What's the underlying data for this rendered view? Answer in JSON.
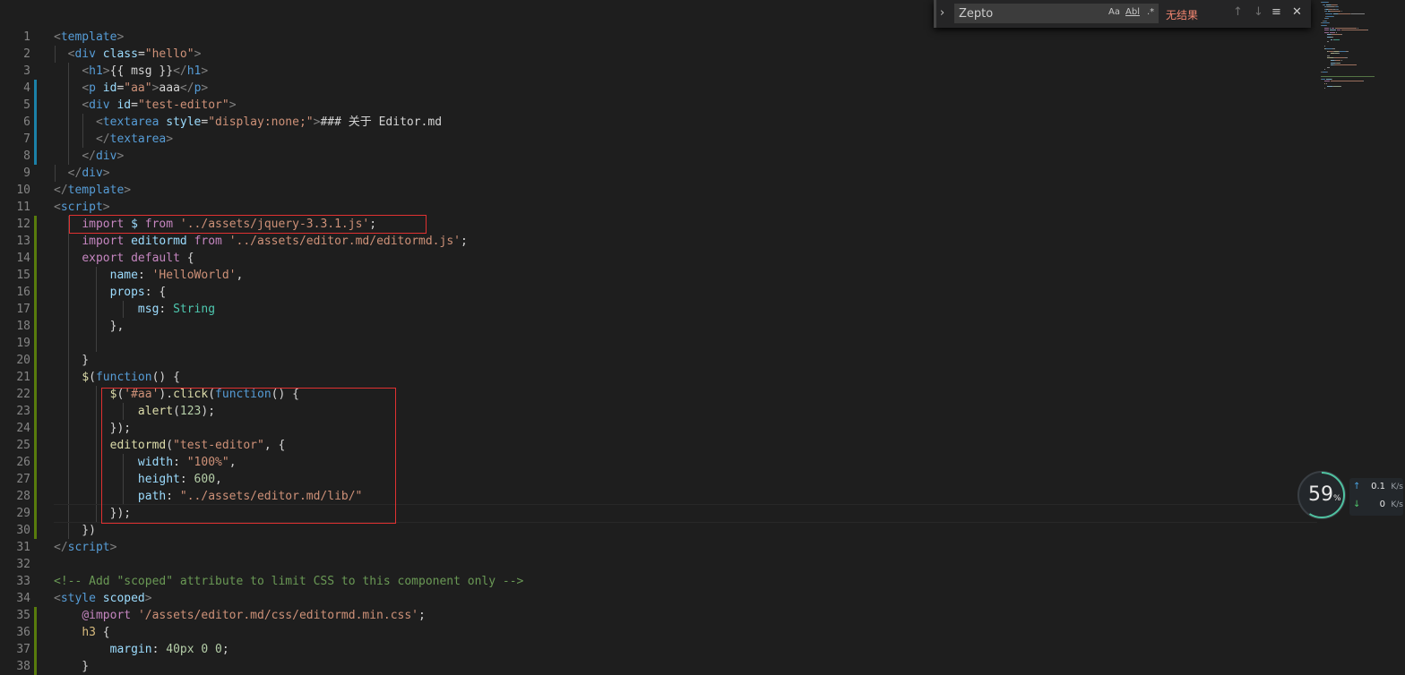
{
  "colors": {
    "accent": "#1b81a8",
    "added": "#587c0c",
    "highlight_box": "#e03131",
    "find_error": "#f48771",
    "net_ring": "#4fc3a1"
  },
  "line_numbers": [
    "1",
    "2",
    "3",
    "4",
    "5",
    "6",
    "7",
    "8",
    "9",
    "10",
    "11",
    "12",
    "13",
    "14",
    "15",
    "16",
    "17",
    "18",
    "19",
    "20",
    "21",
    "22",
    "23",
    "24",
    "25",
    "26",
    "27",
    "28",
    "29",
    "30",
    "31",
    "32",
    "33",
    "34",
    "35",
    "36",
    "37",
    "38"
  ],
  "lines": [
    [
      [
        "t-br",
        "<"
      ],
      [
        "t-tag",
        "template"
      ],
      [
        "t-br",
        ">"
      ]
    ],
    [
      [
        "t-txt",
        "  "
      ],
      [
        "t-br",
        "<"
      ],
      [
        "t-tag",
        "div"
      ],
      [
        "t-txt",
        " "
      ],
      [
        "t-attr",
        "class"
      ],
      [
        "t-txt",
        "="
      ],
      [
        "t-str",
        "\"hello\""
      ],
      [
        "t-br",
        ">"
      ]
    ],
    [
      [
        "t-txt",
        "    "
      ],
      [
        "t-br",
        "<"
      ],
      [
        "t-tag",
        "h1"
      ],
      [
        "t-br",
        ">"
      ],
      [
        "t-txt",
        "{{ msg }}"
      ],
      [
        "t-br",
        "</"
      ],
      [
        "t-tag",
        "h1"
      ],
      [
        "t-br",
        ">"
      ]
    ],
    [
      [
        "t-txt",
        "    "
      ],
      [
        "t-br",
        "<"
      ],
      [
        "t-tag",
        "p"
      ],
      [
        "t-txt",
        " "
      ],
      [
        "t-attr",
        "id"
      ],
      [
        "t-txt",
        "="
      ],
      [
        "t-str",
        "\"aa\""
      ],
      [
        "t-br",
        ">"
      ],
      [
        "t-txt",
        "aaa"
      ],
      [
        "t-br",
        "</"
      ],
      [
        "t-tag",
        "p"
      ],
      [
        "t-br",
        ">"
      ]
    ],
    [
      [
        "t-txt",
        "    "
      ],
      [
        "t-br",
        "<"
      ],
      [
        "t-tag",
        "div"
      ],
      [
        "t-txt",
        " "
      ],
      [
        "t-attr",
        "id"
      ],
      [
        "t-txt",
        "="
      ],
      [
        "t-str",
        "\"test-editor\""
      ],
      [
        "t-br",
        ">"
      ]
    ],
    [
      [
        "t-txt",
        "      "
      ],
      [
        "t-br",
        "<"
      ],
      [
        "t-tag",
        "textarea"
      ],
      [
        "t-txt",
        " "
      ],
      [
        "t-attr",
        "style"
      ],
      [
        "t-txt",
        "="
      ],
      [
        "t-str",
        "\"display:none;\""
      ],
      [
        "t-br",
        ">"
      ],
      [
        "t-txt",
        "### 关于 Editor.md"
      ]
    ],
    [
      [
        "t-txt",
        "      "
      ],
      [
        "t-br",
        "</"
      ],
      [
        "t-tag",
        "textarea"
      ],
      [
        "t-br",
        ">"
      ]
    ],
    [
      [
        "t-txt",
        "    "
      ],
      [
        "t-br",
        "</"
      ],
      [
        "t-tag",
        "div"
      ],
      [
        "t-br",
        ">"
      ]
    ],
    [
      [
        "t-txt",
        "  "
      ],
      [
        "t-br",
        "</"
      ],
      [
        "t-tag",
        "div"
      ],
      [
        "t-br",
        ">"
      ]
    ],
    [
      [
        "t-br",
        "</"
      ],
      [
        "t-tag",
        "template"
      ],
      [
        "t-br",
        ">"
      ]
    ],
    [
      [
        "t-br",
        "<"
      ],
      [
        "t-tag",
        "script"
      ],
      [
        "t-br",
        ">"
      ]
    ],
    [
      [
        "t-txt",
        "    "
      ],
      [
        "t-kw",
        "import"
      ],
      [
        "t-txt",
        " "
      ],
      [
        "t-var",
        "$"
      ],
      [
        "t-txt",
        " "
      ],
      [
        "t-kw",
        "from"
      ],
      [
        "t-txt",
        " "
      ],
      [
        "t-str",
        "'../assets/jquery-3.3.1.js'"
      ],
      [
        "t-txt",
        ";"
      ]
    ],
    [
      [
        "t-txt",
        "    "
      ],
      [
        "t-kw",
        "import"
      ],
      [
        "t-txt",
        " "
      ],
      [
        "t-var",
        "editormd"
      ],
      [
        "t-txt",
        " "
      ],
      [
        "t-kw",
        "from"
      ],
      [
        "t-txt",
        " "
      ],
      [
        "t-str",
        "'../assets/editor.md/editormd.js'"
      ],
      [
        "t-txt",
        ";"
      ]
    ],
    [
      [
        "t-txt",
        "    "
      ],
      [
        "t-kw",
        "export"
      ],
      [
        "t-txt",
        " "
      ],
      [
        "t-kw",
        "default"
      ],
      [
        "t-txt",
        " {"
      ]
    ],
    [
      [
        "t-txt",
        "        "
      ],
      [
        "t-var",
        "name"
      ],
      [
        "t-txt",
        ": "
      ],
      [
        "t-str",
        "'HelloWorld'"
      ],
      [
        "t-txt",
        ","
      ]
    ],
    [
      [
        "t-txt",
        "        "
      ],
      [
        "t-var",
        "props"
      ],
      [
        "t-txt",
        ": {"
      ]
    ],
    [
      [
        "t-txt",
        "            "
      ],
      [
        "t-var",
        "msg"
      ],
      [
        "t-txt",
        ": "
      ],
      [
        "t-type",
        "String"
      ]
    ],
    [
      [
        "t-txt",
        "        },"
      ]
    ],
    [
      [
        "t-txt",
        ""
      ]
    ],
    [
      [
        "t-txt",
        "    }"
      ]
    ],
    [
      [
        "t-txt",
        "    "
      ],
      [
        "t-fn",
        "$"
      ],
      [
        "t-txt",
        "("
      ],
      [
        "t-kw2",
        "function"
      ],
      [
        "t-txt",
        "() {"
      ]
    ],
    [
      [
        "t-txt",
        "        "
      ],
      [
        "t-fn",
        "$"
      ],
      [
        "t-txt",
        "("
      ],
      [
        "t-str",
        "'#aa'"
      ],
      [
        "t-txt",
        ")."
      ],
      [
        "t-fn",
        "click"
      ],
      [
        "t-txt",
        "("
      ],
      [
        "t-kw2",
        "function"
      ],
      [
        "t-txt",
        "() {"
      ]
    ],
    [
      [
        "t-txt",
        "            "
      ],
      [
        "t-fn",
        "alert"
      ],
      [
        "t-txt",
        "("
      ],
      [
        "t-num",
        "123"
      ],
      [
        "t-txt",
        ");"
      ]
    ],
    [
      [
        "t-txt",
        "        });"
      ]
    ],
    [
      [
        "t-txt",
        "        "
      ],
      [
        "t-fn",
        "editormd"
      ],
      [
        "t-txt",
        "("
      ],
      [
        "t-str",
        "\"test-editor\""
      ],
      [
        "t-txt",
        ", {"
      ]
    ],
    [
      [
        "t-txt",
        "            "
      ],
      [
        "t-var",
        "width"
      ],
      [
        "t-txt",
        ": "
      ],
      [
        "t-str",
        "\"100%\""
      ],
      [
        "t-txt",
        ","
      ]
    ],
    [
      [
        "t-txt",
        "            "
      ],
      [
        "t-var",
        "height"
      ],
      [
        "t-txt",
        ": "
      ],
      [
        "t-num",
        "600"
      ],
      [
        "t-txt",
        ","
      ]
    ],
    [
      [
        "t-txt",
        "            "
      ],
      [
        "t-var",
        "path"
      ],
      [
        "t-txt",
        ": "
      ],
      [
        "t-str",
        "\"../assets/editor.md/lib/\""
      ]
    ],
    [
      [
        "t-txt",
        "        });"
      ]
    ],
    [
      [
        "t-txt",
        "    })"
      ]
    ],
    [
      [
        "t-br",
        "</"
      ],
      [
        "t-tag",
        "script"
      ],
      [
        "t-br",
        ">"
      ]
    ],
    [
      [
        "t-txt",
        ""
      ]
    ],
    [
      [
        "t-com",
        "<!-- Add \"scoped\" attribute to limit CSS to this component only -->"
      ]
    ],
    [
      [
        "t-br",
        "<"
      ],
      [
        "t-tag",
        "style"
      ],
      [
        "t-txt",
        " "
      ],
      [
        "t-attr",
        "scoped"
      ],
      [
        "t-br",
        ">"
      ]
    ],
    [
      [
        "t-txt",
        "    "
      ],
      [
        "t-kw",
        "@import"
      ],
      [
        "t-txt",
        " "
      ],
      [
        "t-str",
        "'/assets/editor.md/css/editormd.min.css'"
      ],
      [
        "t-txt",
        ";"
      ]
    ],
    [
      [
        "t-txt",
        "    "
      ],
      [
        "t-sel",
        "h3"
      ],
      [
        "t-txt",
        " {"
      ]
    ],
    [
      [
        "t-txt",
        "        "
      ],
      [
        "t-prop",
        "margin"
      ],
      [
        "t-txt",
        ": "
      ],
      [
        "t-num",
        "40px 0 0"
      ],
      [
        "t-txt",
        ";"
      ]
    ],
    [
      [
        "t-txt",
        "    }"
      ]
    ]
  ],
  "find": {
    "query": "Zepto",
    "match_case_label": "Aa",
    "whole_word_label": "Abl",
    "regex_label": ".*",
    "status": "无结果",
    "toggle_icon": "chevron-right-icon",
    "prev_icon": "arrow-up-icon",
    "next_icon": "arrow-down-icon",
    "selection_icon": "find-in-selection-icon",
    "close_icon": "close-icon"
  },
  "net_monitor": {
    "percent": "59",
    "percent_sign": "%",
    "percent_value": 59,
    "upload_value": "0.1",
    "upload_unit": "K/s",
    "download_value": "0",
    "download_unit": "K/s"
  }
}
